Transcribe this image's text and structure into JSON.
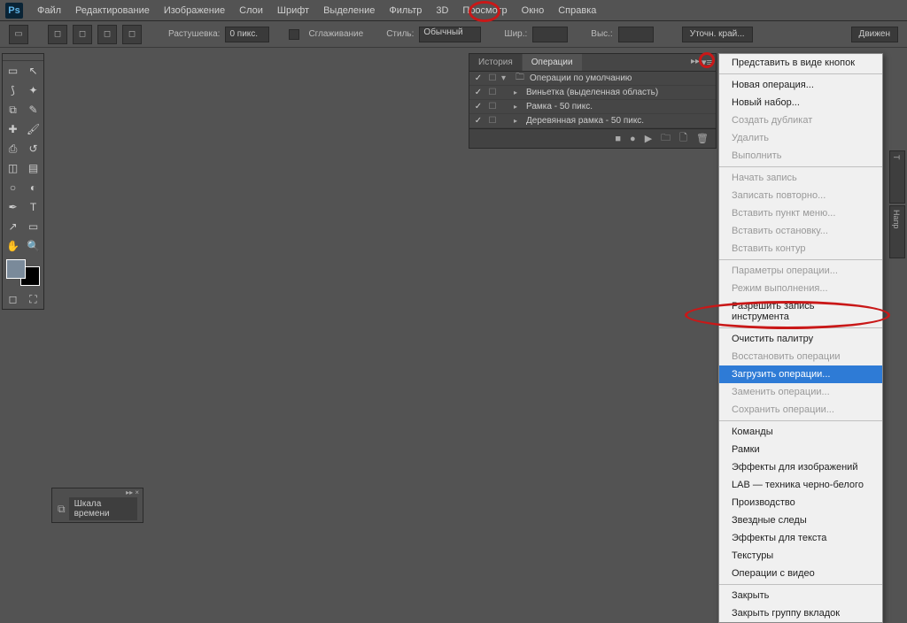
{
  "app": {
    "logo": "Ps"
  },
  "menubar": [
    "Файл",
    "Редактирование",
    "Изображение",
    "Слои",
    "Шрифт",
    "Выделение",
    "Фильтр",
    "3D",
    "Просмотр",
    "Окно",
    "Справка"
  ],
  "optbar": {
    "feather_label": "Растушевка:",
    "feather_value": "0 пикс.",
    "antialias_label": "Сглаживание",
    "style_label": "Стиль:",
    "style_value": "Обычный",
    "width_label": "Шир.:",
    "height_label": "Выс.:",
    "refine_label": "Уточн. край...",
    "drag_label": "Движен"
  },
  "panel": {
    "tab_history": "История",
    "tab_actions": "Операции",
    "actions": [
      {
        "name": "Операции по умолчанию",
        "type": "folder"
      },
      {
        "name": "Виньетка (выделенная область)",
        "type": "action"
      },
      {
        "name": "Рамка - 50 пикс.",
        "type": "action"
      },
      {
        "name": "Деревянная рамка - 50 пикс.",
        "type": "action"
      }
    ]
  },
  "ctx": {
    "items": [
      {
        "label": "Представить в виде кнопок",
        "enabled": true
      },
      {
        "sep": true
      },
      {
        "label": "Новая операция...",
        "enabled": true
      },
      {
        "label": "Новый набор...",
        "enabled": true
      },
      {
        "label": "Создать дубликат",
        "enabled": false
      },
      {
        "label": "Удалить",
        "enabled": false
      },
      {
        "label": "Выполнить",
        "enabled": false
      },
      {
        "sep": true
      },
      {
        "label": "Начать запись",
        "enabled": false
      },
      {
        "label": "Записать повторно...",
        "enabled": false
      },
      {
        "label": "Вставить пункт меню...",
        "enabled": false
      },
      {
        "label": "Вставить остановку...",
        "enabled": false
      },
      {
        "label": "Вставить контур",
        "enabled": false
      },
      {
        "sep": true
      },
      {
        "label": "Параметры операции...",
        "enabled": false
      },
      {
        "label": "Режим выполнения...",
        "enabled": false
      },
      {
        "label": "Разрешить запись инструмента",
        "enabled": true
      },
      {
        "sep": true
      },
      {
        "label": "Очистить палитру",
        "enabled": true
      },
      {
        "label": "Восстановить операции",
        "enabled": false
      },
      {
        "label": "Загрузить операции...",
        "enabled": true,
        "highlighted": true
      },
      {
        "label": "Заменить операции...",
        "enabled": false
      },
      {
        "label": "Сохранить операции...",
        "enabled": false
      },
      {
        "sep": true
      },
      {
        "label": "Команды",
        "enabled": true
      },
      {
        "label": "Рамки",
        "enabled": true
      },
      {
        "label": "Эффекты для изображений",
        "enabled": true
      },
      {
        "label": "LAB — техника черно-белого",
        "enabled": true
      },
      {
        "label": "Производство",
        "enabled": true
      },
      {
        "label": "Звездные следы",
        "enabled": true
      },
      {
        "label": "Эффекты для текста",
        "enabled": true
      },
      {
        "label": "Текстуры",
        "enabled": true
      },
      {
        "label": "Операции с видео",
        "enabled": true
      },
      {
        "sep": true
      },
      {
        "label": "Закрыть",
        "enabled": true
      },
      {
        "label": "Закрыть группу вкладок",
        "enabled": true
      }
    ]
  },
  "timeline": {
    "label": "Шкала времени"
  },
  "right_tabs": [
    "T",
    "Напр"
  ]
}
